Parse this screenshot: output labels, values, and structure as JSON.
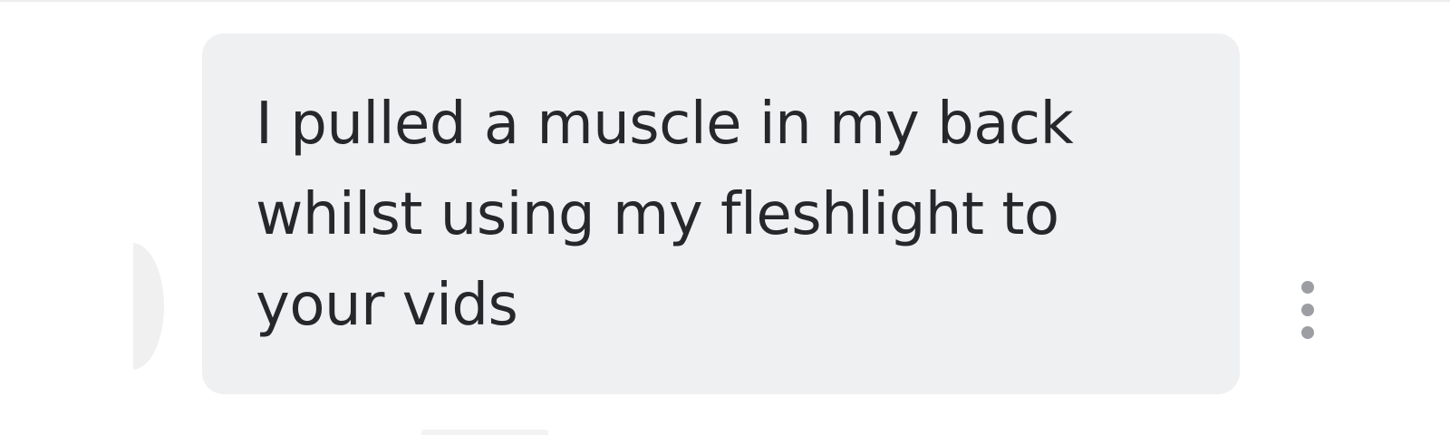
{
  "message": {
    "text": "I pulled a muscle in my back\nwhilst using my fleshlight to\nyour vids"
  },
  "actions": {
    "more_icon": "vertical-ellipsis-icon"
  },
  "colors": {
    "bubble_background": "#eff0f2",
    "text": "#26272b",
    "icon": "#9c9ea4",
    "page_background": "#ffffff"
  }
}
